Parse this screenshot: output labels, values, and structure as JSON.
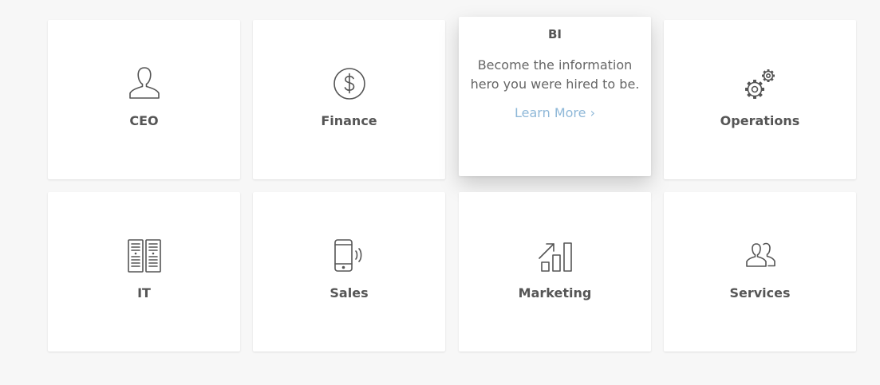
{
  "cards": [
    {
      "label": "CEO",
      "icon": "person-icon"
    },
    {
      "label": "Finance",
      "icon": "dollar-circle-icon"
    },
    {
      "label": "BI",
      "description": "Become the information hero you were hired to be.",
      "link": "Learn More ›",
      "state": "hovered"
    },
    {
      "label": "Operations",
      "icon": "gears-icon"
    },
    {
      "label": "IT",
      "icon": "server-racks-icon"
    },
    {
      "label": "Sales",
      "icon": "mobile-phone-icon"
    },
    {
      "label": "Marketing",
      "icon": "growth-chart-icon"
    },
    {
      "label": "Services",
      "icon": "people-icon"
    }
  ],
  "colors": {
    "background": "#f7f7f7",
    "card": "#ffffff",
    "text": "#555555",
    "link": "#8fb8d8"
  }
}
